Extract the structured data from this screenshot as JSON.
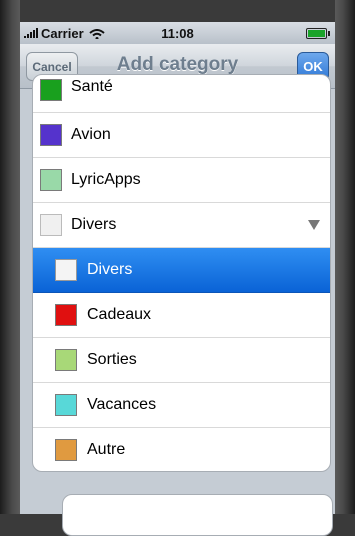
{
  "status_bar": {
    "carrier": "Carrier",
    "time": "11:08"
  },
  "navbar": {
    "title": "Add category",
    "cancel_label": "Cancel",
    "ok_label": "OK"
  },
  "categories": [
    {
      "label": "Santé",
      "color": "#19a01e"
    },
    {
      "label": "Avion",
      "color": "#5533cc"
    },
    {
      "label": "LyricApps",
      "color": "#99d9a8"
    },
    {
      "label": "Divers",
      "color": "#f0f0f0"
    }
  ],
  "subcategories": [
    {
      "label": "Divers",
      "color": "#f4f4f4",
      "selected": true
    },
    {
      "label": "Cadeaux",
      "color": "#e01010"
    },
    {
      "label": "Sorties",
      "color": "#a8d878"
    },
    {
      "label": "Vacances",
      "color": "#58d8d8"
    },
    {
      "label": "Autre",
      "color": "#e09a40"
    }
  ]
}
